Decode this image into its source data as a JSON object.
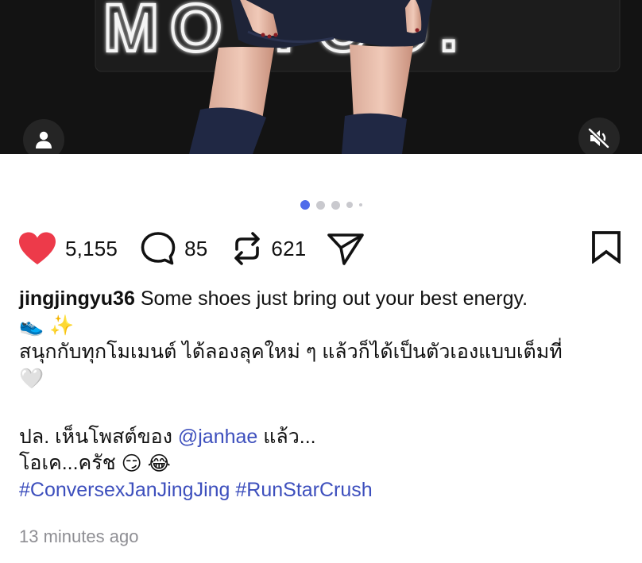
{
  "media": {
    "neon_text": "MO  YOU."
  },
  "icons": {
    "user_tag": "person-icon",
    "mute": "speaker-muted-icon",
    "like": "heart-filled-icon",
    "comment": "comment-bubble-icon",
    "repost": "repost-icon",
    "share": "send-icon",
    "bookmark": "bookmark-icon"
  },
  "pager": {
    "total_visible": 5,
    "active_index": 0,
    "active_color": "#4f6bea"
  },
  "actions": {
    "likes": "5,155",
    "comments": "85",
    "reposts": "621",
    "like_color": "#ed3a4a"
  },
  "caption": {
    "username": "jingjingyu36",
    "line1_text": "Some shoes just bring out your best energy.",
    "line2_emoji": "👟 ✨",
    "line3_thai": "สนุกกับทุกโมเมนต์ ได้ลองลุคใหม่ ๆ แล้วก็ได้เป็นตัวเองแบบเต็มที่",
    "line4_emoji": "🤍",
    "ps_prefix": "ปล. เห็นโพสต์ของ",
    "mention": "@janhae",
    "ps_suffix": "แล้ว...",
    "ok_line": "โอเค...ครัช",
    "ok_emoji": "😏 😂",
    "hashtag1": "#ConversexJanJingJing",
    "hashtag2": "#RunStarCrush",
    "link_color": "#3d4fbd"
  },
  "timestamp": "13 minutes ago"
}
